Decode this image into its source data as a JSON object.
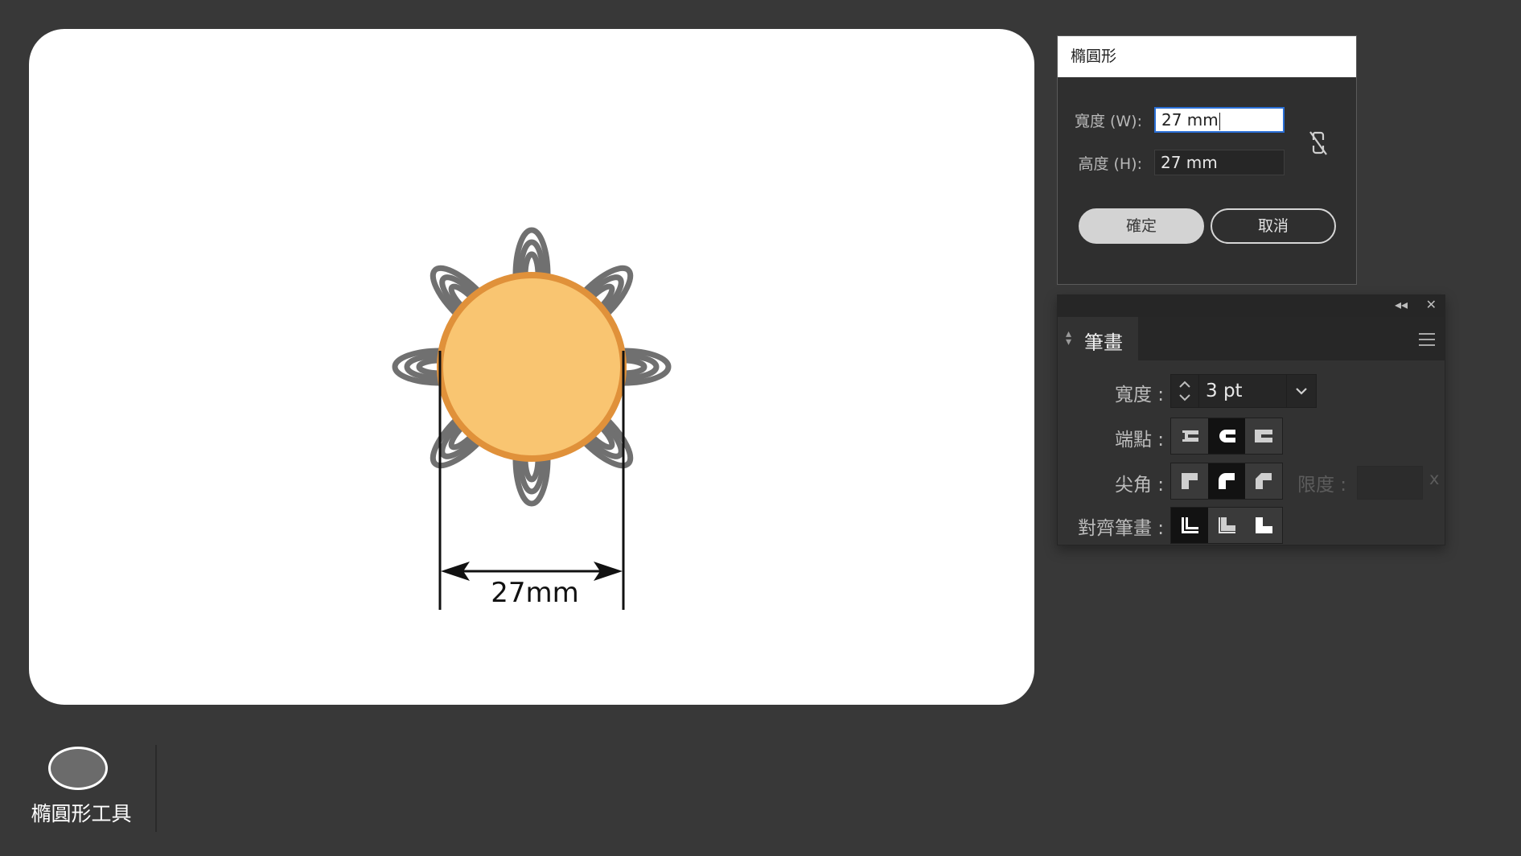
{
  "canvas": {
    "dimension_label": "27mm",
    "colors": {
      "fill": "#f9c571",
      "stroke": "#e0913a",
      "petals": "#707070"
    }
  },
  "ellipse_dialog": {
    "title": "橢圓形",
    "width_label": "寬度 (W):",
    "width_value": "27 mm",
    "height_label": "高度 (H):",
    "height_value": "27 mm",
    "ok_label": "確定",
    "cancel_label": "取消",
    "link_icon": "unlink-icon"
  },
  "stroke_panel": {
    "collapse_glyph": "◂◂",
    "close_glyph": "✕",
    "tab_label": "筆畫",
    "weight_label": "寬度 :",
    "weight_value": "3 pt",
    "cap_label": "端點 :",
    "corner_label": "尖角 :",
    "limit_label": "限度 :",
    "limit_suffix": "x",
    "align_label": "對齊筆畫 :",
    "selected": {
      "cap": "round-cap",
      "corner": "round-join",
      "align": "center"
    }
  },
  "tool": {
    "label": "橢圓形工具",
    "icon": "ellipse-tool-icon"
  }
}
